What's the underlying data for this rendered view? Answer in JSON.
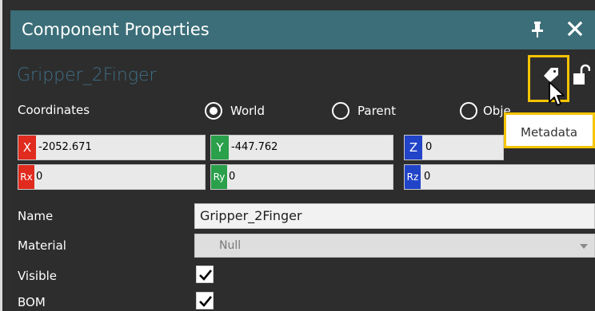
{
  "panel": {
    "title": "Component Properties",
    "component_name": "Gripper_2Finger"
  },
  "coordinates": {
    "label": "Coordinates",
    "options": [
      {
        "label": "World",
        "checked": true
      },
      {
        "label": "Parent",
        "checked": false
      },
      {
        "label": "Obje",
        "checked": false
      }
    ]
  },
  "position": {
    "x": {
      "tag": "X",
      "value": "-2052.671"
    },
    "y": {
      "tag": "Y",
      "value": "-447.762"
    },
    "z": {
      "tag": "Z",
      "value": "0"
    }
  },
  "rotation": {
    "rx": {
      "tag": "Rx",
      "value": "0"
    },
    "ry": {
      "tag": "Ry",
      "value": "0"
    },
    "rz": {
      "tag": "Rz",
      "value": "0"
    }
  },
  "properties": {
    "name_label": "Name",
    "name_value": "Gripper_2Finger",
    "material_label": "Material",
    "material_value": "Null",
    "visible_label": "Visible",
    "visible_checked": true,
    "bom_label": "BOM",
    "bom_checked": true
  },
  "tooltip": {
    "text": "Metadata"
  },
  "colors": {
    "header": "#3b6e78",
    "panel_bg": "#2d2d2d",
    "highlight": "#f5c400",
    "x_tag": "#e02b1e",
    "y_tag": "#2aa04a",
    "z_tag": "#2244c8"
  },
  "icons": [
    "pin-icon",
    "close-icon",
    "tag-icon",
    "unlock-icon",
    "cursor-icon",
    "checkmark-icon",
    "dropdown-arrow-icon"
  ]
}
